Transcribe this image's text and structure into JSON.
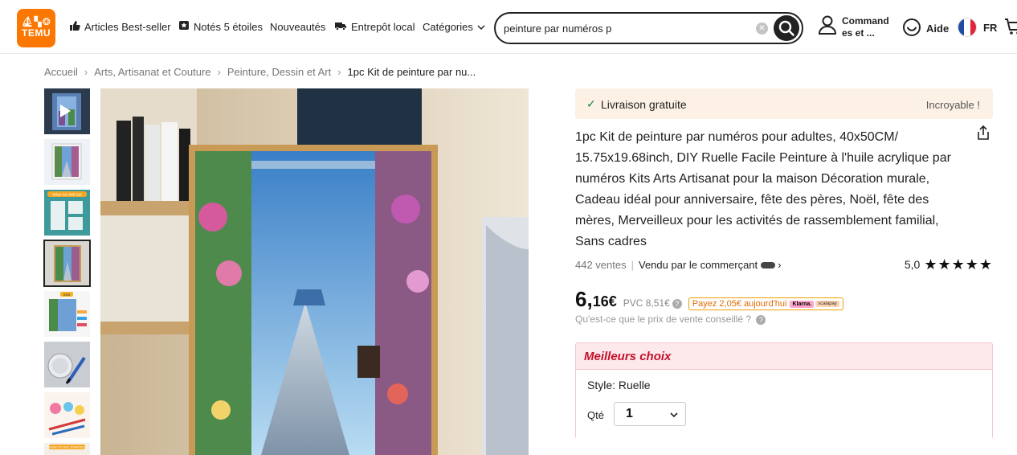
{
  "brand": {
    "logo_glyphs": "⛵︎▚❂",
    "logo_text": "TEMU",
    "color": "#fb7701"
  },
  "nav": {
    "bestsellers": "Articles Best-seller",
    "five_stars": "Notés 5 étoiles",
    "new": "Nouveautés",
    "local": "Entrepôt local",
    "categories": "Catégories"
  },
  "search": {
    "value": "peinture par numéros p"
  },
  "account": {
    "label": "Command es et ..."
  },
  "help": {
    "label": "Aide"
  },
  "lang": {
    "code": "FR"
  },
  "breadcrumb": [
    "Accueil",
    "Arts, Artisanat et Couture",
    "Peinture, Dessin et Art",
    "1pc Kit de peinture par nu..."
  ],
  "gallery": {
    "thumb_icons": [
      "video-thumbnail",
      "painting-preview",
      "what-you-get",
      "painting-selected",
      "size-chart",
      "paint-pots",
      "brushes-kit",
      "how-to-start"
    ],
    "labels": {
      "what_you_get": "What You Will Get",
      "size": "Size",
      "how_to": "HOW TO GET STARTED"
    }
  },
  "product": {
    "free_shipping": "Livraison gratuite",
    "incredible": "Incroyable !",
    "title": "1pc Kit de peinture par numéros pour adultes, 40x50CM/ 15.75x19.68inch, DIY Ruelle Facile Peinture à l'huile acrylique par numéros Kits Arts Artisanat pour la maison Décoration murale, Cadeau idéal pour anniversaire, fête des pères, Noël, fête des mères, Merveilleux pour les activités de rassemblement familial, Sans cadres",
    "sales": "442 ventes",
    "seller": "Vendu par le commerçant",
    "rating": "5,0",
    "stars": "★★★★★",
    "price_main": "6,",
    "price_cents": "16€",
    "rrp": "PVC 8,51€",
    "klarna_text": "Payez 2,05€ aujourd'hui",
    "klarna": "Klarna.",
    "scalapay": "scalapay",
    "rrp_question": "Qu'est-ce que le prix de vente conseillé ?",
    "best_choice": "Meilleurs choix",
    "style": "Style: Ruelle",
    "qty_label": "Qté",
    "qty": "1"
  }
}
